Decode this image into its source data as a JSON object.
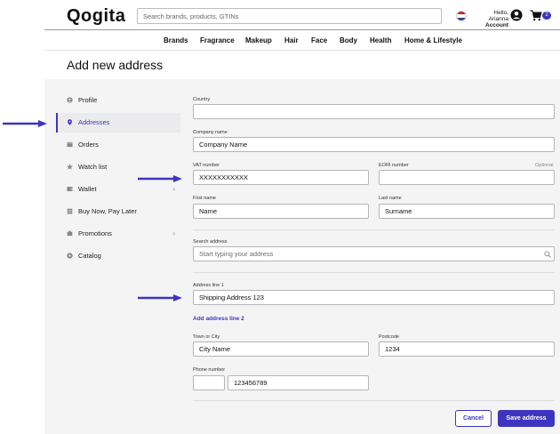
{
  "header": {
    "logo": "Qogita",
    "search_placeholder": "Search brands, products, GTINs",
    "greeting": "Hello, Arianna",
    "account_label": "Account",
    "cart_count": "2"
  },
  "nav": [
    "Brands",
    "Fragrance",
    "Makeup",
    "Hair",
    "Face",
    "Body",
    "Health",
    "Home & Lifestyle"
  ],
  "page_title": "Add new address",
  "sidebar": {
    "items": [
      {
        "label": "Profile",
        "icon": "user-icon"
      },
      {
        "label": "Addresses",
        "icon": "location-pin-icon",
        "active": true
      },
      {
        "label": "Orders",
        "icon": "box-icon"
      },
      {
        "label": "Watch list",
        "icon": "star-icon"
      },
      {
        "label": "Wallet",
        "icon": "wallet-icon",
        "chevron": true
      },
      {
        "label": "Buy Now, Pay Later",
        "icon": "calendar-icon"
      },
      {
        "label": "Promotions",
        "icon": "tag-icon",
        "chevron": true
      },
      {
        "label": "Catalog",
        "icon": "catalog-icon"
      }
    ]
  },
  "form": {
    "country_label": "Country",
    "country_value": "",
    "company_label": "Company name",
    "company_value": "Company Name",
    "vat_label": "VAT number",
    "vat_value": "XXXXXXXXXXX",
    "eori_label": "EORI number",
    "eori_optional": "Optional",
    "eori_value": "",
    "first_name_label": "First name",
    "first_name_value": "Name",
    "last_name_label": "Last name",
    "last_name_value": "Surname",
    "search_address_label": "Search address",
    "search_address_placeholder": "Start typing your address",
    "address1_label": "Address line 1",
    "address1_value": "Shipping Address 123",
    "add_line_link": "Add address line 2",
    "town_label": "Town or City",
    "town_value": "City Name",
    "postcode_label": "Postcode",
    "postcode_value": "1234",
    "phone_label": "Phone number",
    "phone_code": "",
    "phone_value": "123456789",
    "cancel_label": "Cancel",
    "save_label": "Save address"
  },
  "colors": {
    "accent": "#3d35c0",
    "panel_bg": "#f4f4f5"
  }
}
